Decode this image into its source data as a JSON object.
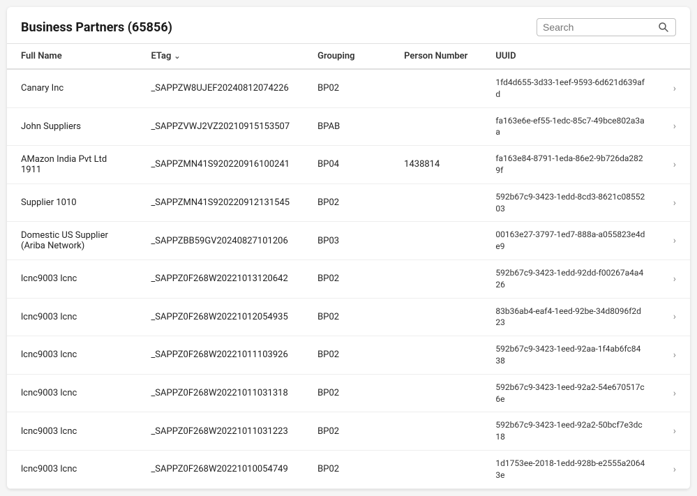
{
  "header": {
    "title": "Business Partners (65856)",
    "search": {
      "placeholder": "Search"
    }
  },
  "columns": [
    {
      "key": "fullname",
      "label": "Full Name"
    },
    {
      "key": "etag",
      "label": "ETag"
    },
    {
      "key": "grouping",
      "label": "Grouping"
    },
    {
      "key": "person_number",
      "label": "Person Number"
    },
    {
      "key": "uuid",
      "label": "UUID"
    }
  ],
  "rows": [
    {
      "fullname": "Canary Inc",
      "etag": "_SAPPZW8UJEF20240812074226",
      "grouping": "BP02",
      "person_number": "",
      "uuid": "1fd4d655-3d33-1eef-9593-6d621d639afd"
    },
    {
      "fullname": "John Suppliers",
      "etag": "_SAPPZVWJ2VZ20210915153507",
      "grouping": "BPAB",
      "person_number": "",
      "uuid": "fa163e6e-ef55-1edc-85c7-49bce802a3aa"
    },
    {
      "fullname": "AMazon India Pvt Ltd 1911",
      "etag": "_SAPPZMN41S920220916100241",
      "grouping": "BP04",
      "person_number": "1438814",
      "uuid": "fa163e84-8791-1eda-86e2-9b726da2829f"
    },
    {
      "fullname": "Supplier 1010",
      "etag": "_SAPPZMN41S920220912131545",
      "grouping": "BP02",
      "person_number": "",
      "uuid": "592b67c9-3423-1edd-8cd3-8621c0855203"
    },
    {
      "fullname": "Domestic US Supplier (Ariba Network)",
      "etag": "_SAPPZBB59GV20240827101206",
      "grouping": "BP03",
      "person_number": "",
      "uuid": "00163e27-3797-1ed7-888a-a055823e4de9"
    },
    {
      "fullname": "lcnc9003 lcnc",
      "etag": "_SAPPZ0F268W20221013120642",
      "grouping": "BP02",
      "person_number": "",
      "uuid": "592b67c9-3423-1edd-92dd-f00267a4a426"
    },
    {
      "fullname": "lcnc9003 lcnc",
      "etag": "_SAPPZ0F268W20221012054935",
      "grouping": "BP02",
      "person_number": "",
      "uuid": "83b36ab4-eaf4-1eed-92be-34d8096f2d23"
    },
    {
      "fullname": "lcnc9003 lcnc",
      "etag": "_SAPPZ0F268W20221011103926",
      "grouping": "BP02",
      "person_number": "",
      "uuid": "592b67c9-3423-1eed-92aa-1f4ab6fc8438"
    },
    {
      "fullname": "lcnc9003 lcnc",
      "etag": "_SAPPZ0F268W20221011031318",
      "grouping": "BP02",
      "person_number": "",
      "uuid": "592b67c9-3423-1eed-92a2-54e670517c6e"
    },
    {
      "fullname": "lcnc9003 lcnc",
      "etag": "_SAPPZ0F268W20221011031223",
      "grouping": "BP02",
      "person_number": "",
      "uuid": "592b67c9-3423-1eed-92a2-50bcf7e3dc18"
    },
    {
      "fullname": "lcnc9003 lcnc",
      "etag": "_SAPPZ0F268W20221010054749",
      "grouping": "BP02",
      "person_number": "",
      "uuid": "1d1753ee-2018-1edd-928b-e2555a20643e"
    }
  ]
}
